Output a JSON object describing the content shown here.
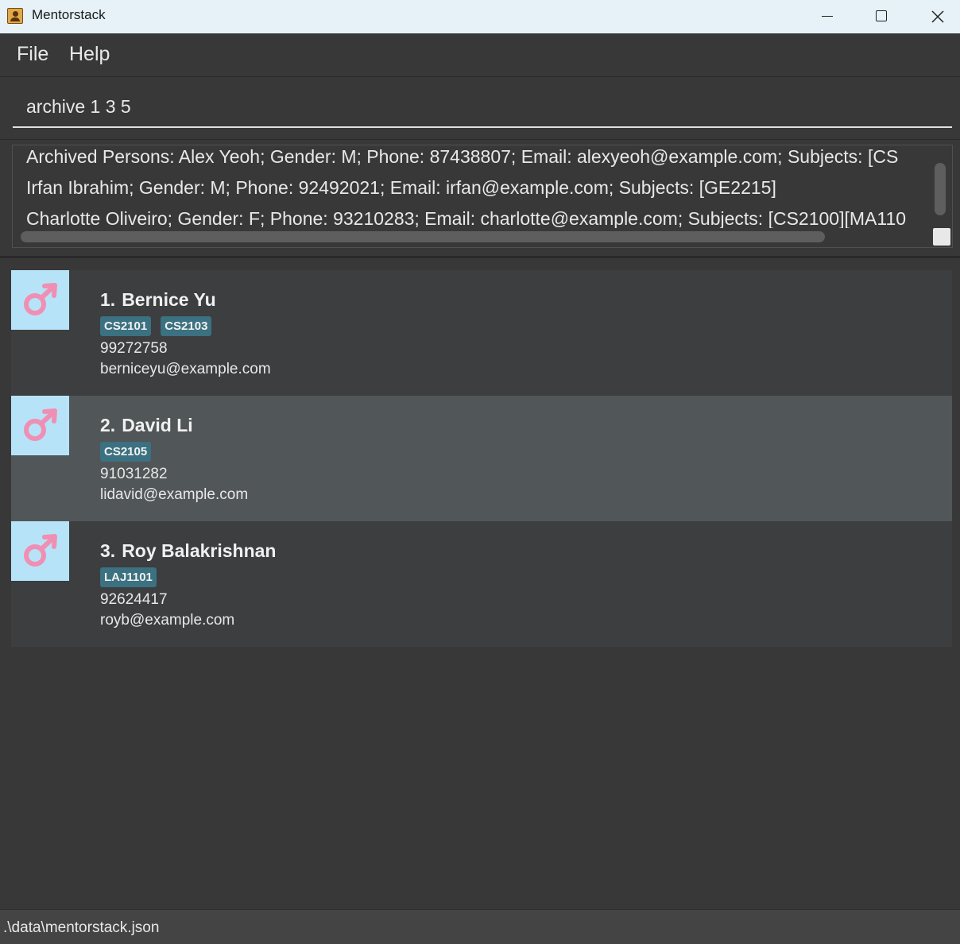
{
  "window": {
    "title": "Mentorstack"
  },
  "menu": {
    "items": [
      "File",
      "Help"
    ]
  },
  "command": {
    "value": "archive 1 3 5"
  },
  "result": {
    "lines": [
      "Archived Persons: Alex Yeoh; Gender: M; Phone: 87438807; Email: alexyeoh@example.com; Subjects: [CS",
      "Irfan Ibrahim; Gender: M; Phone: 92492021; Email: irfan@example.com; Subjects: [GE2215]",
      "Charlotte Oliveiro; Gender: F; Phone: 93210283; Email: charlotte@example.com; Subjects: [CS2100][MA110"
    ]
  },
  "persons": [
    {
      "index": "1.",
      "name": "Bernice Yu",
      "tags": [
        "CS2101",
        "CS2103"
      ],
      "phone": "99272758",
      "email": "berniceyu@example.com",
      "gender_icon": "male-icon",
      "selected": false
    },
    {
      "index": "2.",
      "name": "David Li",
      "tags": [
        "CS2105"
      ],
      "phone": "91031282",
      "email": "lidavid@example.com",
      "gender_icon": "male-icon",
      "selected": true
    },
    {
      "index": "3.",
      "name": "Roy Balakrishnan",
      "tags": [
        "LAJ1101"
      ],
      "phone": "92624417",
      "email": "royb@example.com",
      "gender_icon": "male-icon",
      "selected": false
    }
  ],
  "status": {
    "path": ".\\data\\mentorstack.json"
  },
  "colors": {
    "background": "#383838",
    "card": "#3c3e3f",
    "card_selected": "#515658",
    "tag": "#3b7180",
    "avatar_bg": "#b7e3f8",
    "gender_symbol": "#f08fb4"
  }
}
